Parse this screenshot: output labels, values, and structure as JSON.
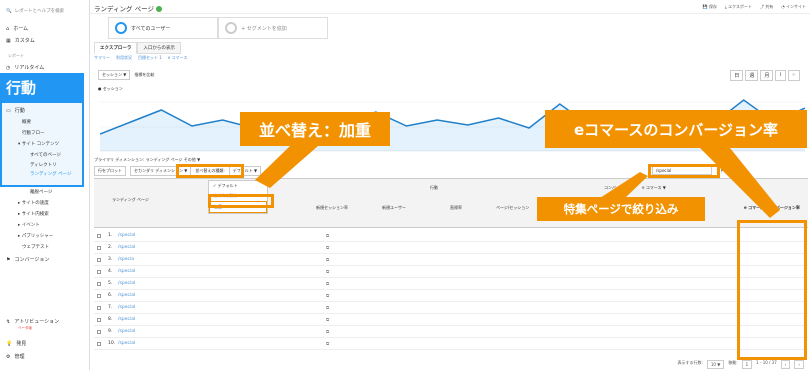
{
  "sidebar": {
    "search_placeholder": "レポートとヘルプを検索",
    "home": "ホーム",
    "custom": "カスタム",
    "report_section": "レポート",
    "realtime": "リアルタイム",
    "behavior_banner": "行動",
    "behavior": "行動",
    "overview": "概要",
    "behavior_flow": "行動フロー",
    "site_content": "サイト コンテンツ",
    "all_pages": "すべてのページ",
    "directory": "ディレクトリ",
    "landing_pages": "ランディング ページ",
    "exit_pages": "離脱ページ",
    "site_speed": "サイトの速度",
    "site_search": "サイト内検索",
    "events": "イベント",
    "publisher": "パブリッシャー",
    "experiments": "ウェブテスト",
    "conversions": "コンバージョン",
    "attribution": "アトリビューション",
    "attribution_beta": "ベータ版",
    "discover": "発見",
    "admin": "管理"
  },
  "header": {
    "title": "ランディング ページ",
    "save": "保存",
    "export": "エクスポート",
    "share": "共有",
    "insight": "インサイト"
  },
  "segments": {
    "all_users": "すべてのユーザー",
    "add_segment": "+ セグメントを追加"
  },
  "tabs": {
    "explorer": "エクスプローラ",
    "entrance_paths": "入口からの表示"
  },
  "subtabs": [
    "サマリー",
    "利用状況",
    "目標セット 1",
    "e コマース"
  ],
  "chart_controls": {
    "metric": "セッション",
    "vs": "▼",
    "compare": "指標を比較"
  },
  "legend": "● セッション",
  "dimension_row": "プライマリ ディメンション: ランディング ページ   その他 ▼",
  "toolbar": {
    "plot": "行をプロット",
    "secondary": "セカンダリ ディメンション ▼",
    "sort_label": "並べ替えの種類:",
    "sort_value": "デフォルト ▼",
    "search_value": "/special",
    "advanced": "アドバンス"
  },
  "dropdown": {
    "opt1": "✓ デフォルト",
    "opt2": "絶対的な変化",
    "opt3": "加重"
  },
  "table_header": {
    "landing_page": "ランディング ページ",
    "behavior": "行動",
    "conversions": "コンバージョン",
    "ecommerce": "e コマース ▼",
    "new_sessions": "新規セッション率",
    "new_users": "新規ユーザー",
    "bounce": "直帰率",
    "pages_session": "ページ/セッション",
    "ecomm_rate": "e コマースのコンバージョン率"
  },
  "rows": [
    {
      "n": "1.",
      "page": "/special"
    },
    {
      "n": "2.",
      "page": "/special"
    },
    {
      "n": "3.",
      "page": "/specia"
    },
    {
      "n": "4.",
      "page": "/special"
    },
    {
      "n": "5.",
      "page": "/special"
    },
    {
      "n": "6.",
      "page": "/special"
    },
    {
      "n": "7.",
      "page": "/special"
    },
    {
      "n": "8.",
      "page": "/special"
    },
    {
      "n": "9.",
      "page": "/special"
    },
    {
      "n": "10.",
      "page": "/special"
    }
  ],
  "callouts": {
    "sort_weighted": "並べ替え：加重",
    "ecomm_rate": "eコマースのコンバージョン率",
    "filter_special": "特集ページで絞り込み"
  },
  "footer": {
    "rows_label": "表示する行数:",
    "rows_value": "10 ▼",
    "goto": "移動:",
    "goto_value": "1",
    "range": "1 - 10 / 37"
  },
  "colors": {
    "accent": "#f39200",
    "blue": "#2196f3",
    "line": "#1f7fc9"
  }
}
